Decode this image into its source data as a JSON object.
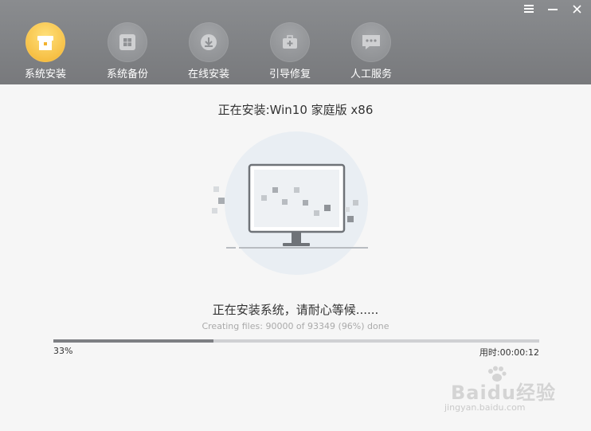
{
  "window": {
    "menu_icon": "menu-icon",
    "minimize_icon": "minimize-icon",
    "close_icon": "close-icon"
  },
  "nav": {
    "items": [
      {
        "label": "系统安装",
        "icon": "install-box-icon",
        "active": true
      },
      {
        "label": "系统备份",
        "icon": "windows-backup-icon",
        "active": false
      },
      {
        "label": "在线安装",
        "icon": "download-icon",
        "active": false
      },
      {
        "label": "引导修复",
        "icon": "toolbox-icon",
        "active": false
      },
      {
        "label": "人工服务",
        "icon": "chat-bubble-icon",
        "active": false
      }
    ]
  },
  "install": {
    "title": "正在安装:Win10 家庭版 x86",
    "status": "正在安装系统，请耐心等候......",
    "detail": "Creating files: 90000 of 93349 (96%) done",
    "progress_percent": 33,
    "percent_label": "33%",
    "elapsed_label": "用时:00:00:12"
  },
  "watermark": {
    "brand": "Baidu经验",
    "url": "jingyan.baidu.com"
  },
  "colors": {
    "toolbar": "#808285",
    "active_accent": "#f3b22e",
    "progress_fill": "#7d7f83",
    "progress_track": "#cfd0d3"
  }
}
